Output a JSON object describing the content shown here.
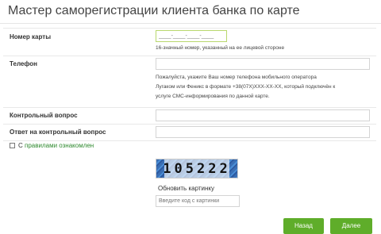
{
  "header": {
    "title": "Мастер саморегистрации клиента банка по карте"
  },
  "form": {
    "card": {
      "label": "Номер карты",
      "placeholder": "____-____-____-____",
      "hint": "16-значный номер, указанный на ее лицевой стороне"
    },
    "phone": {
      "label": "Телефон",
      "hint_lines": [
        "Пожалуйста, укажите Ваш номер телефона мобильного оператора",
        "Лугаком или Феникс в формате +38(07X)XXX-XX-XX, который подключён к",
        "услуге СМС-информирования по данной карте."
      ]
    },
    "question": {
      "label": "Контрольный вопрос"
    },
    "answer": {
      "label": "Ответ на контрольный вопрос"
    },
    "agree": {
      "prefix": "С ",
      "link": "правилами ознакомлен"
    },
    "captcha": {
      "text": "105222",
      "refresh": "Обновить картинку",
      "placeholder": "Введите код с картинки"
    }
  },
  "buttons": {
    "back": "Назад",
    "next": "Далее"
  }
}
